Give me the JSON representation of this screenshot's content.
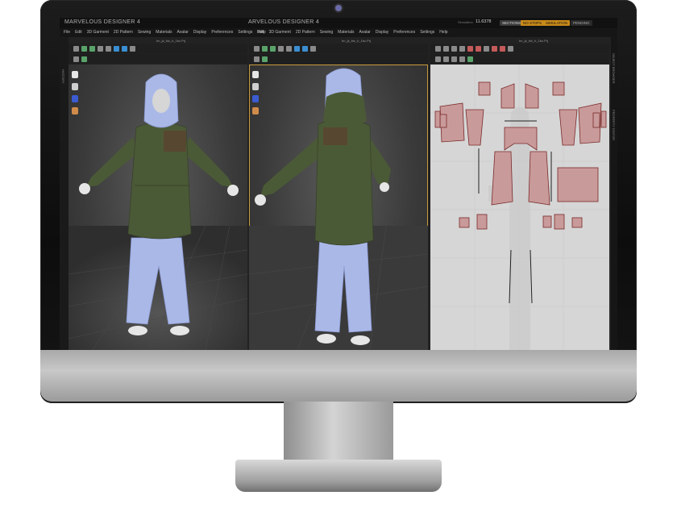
{
  "app": {
    "title_left": "MARVELOUS DESIGNER 4",
    "title_right": "ARVELOUS DESIGNER 4",
    "status_value": "11.6378",
    "badges": [
      "SECTIONS",
      "NO STOPS",
      "SIMULATION",
      "PENDING"
    ]
  },
  "menu_left": [
    "File",
    "Edit",
    "3D Garment",
    "2D Pattern",
    "Sewing",
    "Materials",
    "Avatar",
    "Display",
    "Preferences",
    "Settings",
    "Help"
  ],
  "menu_right": [
    "Edit",
    "3D Garment",
    "2D Pattern",
    "Sewing",
    "Materials",
    "Avatar",
    "Display",
    "Preferences",
    "Settings",
    "Help"
  ],
  "viewports": {
    "left_title": "hn_jk_blc_h_1bc.Prj",
    "mid_title": "hn_jk_blc_h_1bc.Prj",
    "right_title": "hn_jk_blc_h_1bc.Prj"
  },
  "side_panels": {
    "left": "HISTORY",
    "right_top": "OBJECT BROWSER",
    "right_bottom": "PROPERTY EDITOR"
  },
  "colors": {
    "jacket": "#4b5a36",
    "pants": "#aab8e8",
    "avatar_skin": "#e6e6e6",
    "pattern_fill": "#c99a9a",
    "pattern_line": "#7a2a2a",
    "selected_border": "#c79a3c"
  },
  "icons": [
    "avatar-front-icon",
    "avatar-side-icon",
    "magnet-icon",
    "head-icon"
  ]
}
